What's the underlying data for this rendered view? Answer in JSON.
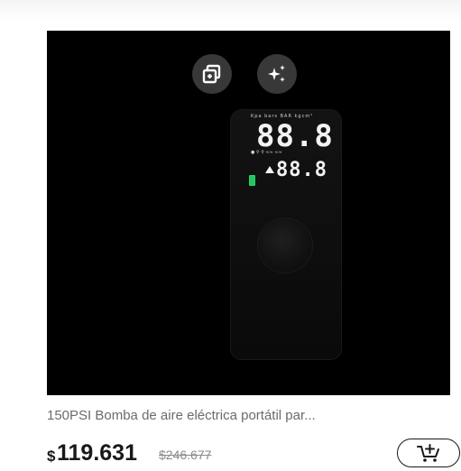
{
  "product": {
    "title": "150PSI Bomba de aire eléctrica portátil par...",
    "currency_symbol": "$",
    "price": "119.631",
    "original_price": "$246.677"
  },
  "device_display": {
    "main_digits": "88.8",
    "secondary_digits": "88.8",
    "units_row": "Kpa  bars  BAR  kgcm²",
    "icons_row": "●  ⚲  ⚲  ≈≈  ≈≈"
  },
  "icons": {
    "similar": "similar-items-icon",
    "ai": "ai-sparkle-icon",
    "cart": "add-to-cart-icon"
  },
  "colors": {
    "text_primary": "#191919",
    "text_secondary": "#6b6b6b",
    "image_bg": "#000000",
    "battery_green": "#22c55e"
  }
}
